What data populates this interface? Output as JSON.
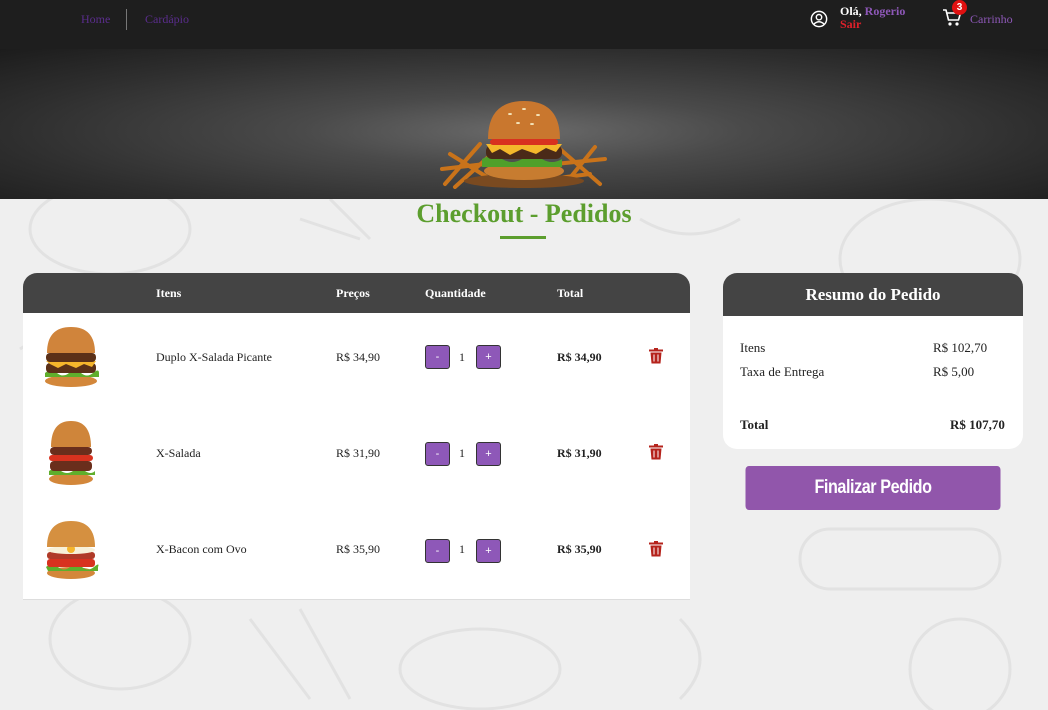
{
  "nav": {
    "home": "Home",
    "menu": "Cardápio"
  },
  "user": {
    "greeting": "Olá,",
    "name": "Rogerio",
    "logout": "Sair"
  },
  "cart": {
    "count": "3",
    "label": "Carrinho"
  },
  "page": {
    "title": "Checkout - Pedidos"
  },
  "table": {
    "headers": {
      "items": "Itens",
      "prices": "Preços",
      "quantity": "Quantidade",
      "total": "Total"
    },
    "rows": [
      {
        "name": "Duplo X-Salada Picante",
        "price": "R$ 34,90",
        "qty": "1",
        "total": "R$ 34,90",
        "minus": "-",
        "plus": "+"
      },
      {
        "name": "X-Salada",
        "price": "R$ 31,90",
        "qty": "1",
        "total": "R$ 31,90",
        "minus": "-",
        "plus": "+"
      },
      {
        "name": "X-Bacon com Ovo",
        "price": "R$ 35,90",
        "qty": "1",
        "total": "R$ 35,90",
        "minus": "-",
        "plus": "+"
      }
    ]
  },
  "summary": {
    "title": "Resumo do Pedido",
    "items_label": "Itens",
    "items_value": "R$ 102,70",
    "delivery_label": "Taxa de Entrega",
    "delivery_value": "R$ 5,00",
    "total_label": "Total",
    "total_value": "R$ 107,70",
    "finalize": "Finalizar Pedido"
  },
  "colors": {
    "accent": "#9156ab",
    "title_green": "#5c9e2e",
    "header_dark": "#444444",
    "logout_red": "#e0202a",
    "trash_red": "#b5231c"
  }
}
